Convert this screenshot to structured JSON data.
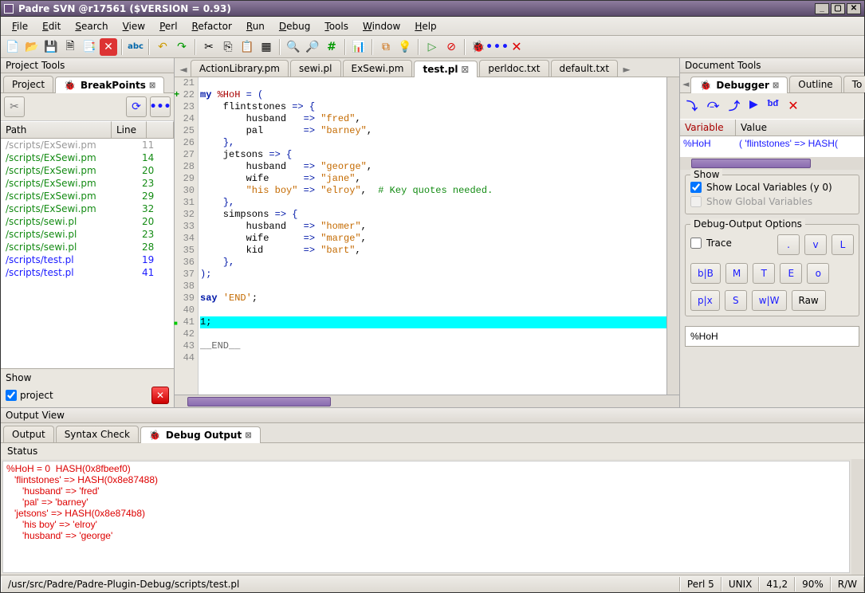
{
  "title": "Padre SVN @r17561 ($VERSION = 0.93)",
  "menus": [
    "File",
    "Edit",
    "Search",
    "View",
    "Perl",
    "Refactor",
    "Run",
    "Debug",
    "Tools",
    "Window",
    "Help"
  ],
  "left_panel": {
    "title": "Project Tools",
    "tabs": {
      "project": "Project",
      "breakpoints": "BreakPoints"
    },
    "columns": {
      "path": "Path",
      "line": "Line"
    },
    "rows": [
      {
        "path": "/scripts/ExSewi.pm",
        "line": "11",
        "cls": "gray"
      },
      {
        "path": "/scripts/ExSewi.pm",
        "line": "14",
        "cls": "green"
      },
      {
        "path": "/scripts/ExSewi.pm",
        "line": "20",
        "cls": "green"
      },
      {
        "path": "/scripts/ExSewi.pm",
        "line": "23",
        "cls": "green"
      },
      {
        "path": "/scripts/ExSewi.pm",
        "line": "29",
        "cls": "green"
      },
      {
        "path": "/scripts/ExSewi.pm",
        "line": "32",
        "cls": "green"
      },
      {
        "path": "/scripts/sewi.pl",
        "line": "20",
        "cls": "green"
      },
      {
        "path": "/scripts/sewi.pl",
        "line": "23",
        "cls": "green"
      },
      {
        "path": "/scripts/sewi.pl",
        "line": "28",
        "cls": "green"
      },
      {
        "path": "/scripts/test.pl",
        "line": "19",
        "cls": "blue"
      },
      {
        "path": "/scripts/test.pl",
        "line": "41",
        "cls": "blue"
      }
    ],
    "show_label": "Show",
    "show_project": "project"
  },
  "file_tabs": [
    "ActionLibrary.pm",
    "sewi.pl",
    "ExSewi.pm",
    "test.pl",
    "perldoc.txt",
    "default.txt"
  ],
  "file_tab_active": 3,
  "code_start_line": 21,
  "code_lines": [
    {
      "n": 21,
      "html": ""
    },
    {
      "n": 22,
      "plus": true,
      "html": "<span class=\"kw\">my</span> <span class=\"var\">%HoH</span> <span class=\"op\">= (</span>"
    },
    {
      "n": 23,
      "html": "    flintstones <span class=\"op\">=&gt; {</span>"
    },
    {
      "n": 24,
      "html": "        husband   <span class=\"op\">=&gt;</span> <span class=\"str\">\"fred\"</span>,"
    },
    {
      "n": 25,
      "html": "        pal       <span class=\"op\">=&gt;</span> <span class=\"str\">\"barney\"</span>,"
    },
    {
      "n": 26,
      "html": "    <span class=\"op\">},</span>"
    },
    {
      "n": 27,
      "html": "    jetsons <span class=\"op\">=&gt; {</span>"
    },
    {
      "n": 28,
      "html": "        husband   <span class=\"op\">=&gt;</span> <span class=\"str\">\"george\"</span>,"
    },
    {
      "n": 29,
      "html": "        wife      <span class=\"op\">=&gt;</span> <span class=\"str\">\"jane\"</span>,"
    },
    {
      "n": 30,
      "html": "        <span class=\"str\">\"his boy\"</span> <span class=\"op\">=&gt;</span> <span class=\"str\">\"elroy\"</span>,  <span class=\"cmt\"># Key quotes needed.</span>"
    },
    {
      "n": 31,
      "html": "    <span class=\"op\">},</span>"
    },
    {
      "n": 32,
      "html": "    simpsons <span class=\"op\">=&gt; {</span>"
    },
    {
      "n": 33,
      "html": "        husband   <span class=\"op\">=&gt;</span> <span class=\"str\">\"homer\"</span>,"
    },
    {
      "n": 34,
      "html": "        wife      <span class=\"op\">=&gt;</span> <span class=\"str\">\"marge\"</span>,"
    },
    {
      "n": 35,
      "html": "        kid       <span class=\"op\">=&gt;</span> <span class=\"str\">\"bart\"</span>,"
    },
    {
      "n": 36,
      "html": "    <span class=\"op\">},</span>"
    },
    {
      "n": 37,
      "html": "<span class=\"op\">);</span>"
    },
    {
      "n": 38,
      "html": ""
    },
    {
      "n": 39,
      "html": "<span class=\"kw\">say</span> <span class=\"str\">'END'</span>;"
    },
    {
      "n": 40,
      "html": ""
    },
    {
      "n": 41,
      "mark": true,
      "hl": true,
      "html": "1;"
    },
    {
      "n": 42,
      "html": ""
    },
    {
      "n": 43,
      "html": "<span class=\"end\">__END__</span>"
    },
    {
      "n": 44,
      "html": ""
    }
  ],
  "right_panel": {
    "title": "Document Tools",
    "tabs": {
      "debugger": "Debugger",
      "outline": "Outline",
      "extra": "To"
    },
    "var_col": "Variable",
    "val_col": "Value",
    "var_name": "%HoH",
    "var_value": "(   'flintstones' => HASH(",
    "show_group": "Show",
    "show_local": "Show Local Variables (y 0)",
    "show_global": "Show Global Variables",
    "out_group": "Debug-Output Options",
    "trace": "Trace",
    "btns1": [
      ".",
      "v",
      "L"
    ],
    "btns2": [
      "b|B",
      "M",
      "T",
      "E",
      "o"
    ],
    "btns3": [
      "p|x",
      "S",
      "w|W",
      "Raw"
    ],
    "input": "%HoH"
  },
  "output_view": {
    "title": "Output View",
    "tabs": [
      "Output",
      "Syntax Check",
      "Debug Output"
    ],
    "active": 2,
    "status": "Status",
    "text": "%HoH = 0  HASH(0x8fbeef0)\n   'flintstones' => HASH(0x8e87488)\n      'husband' => 'fred'\n      'pal' => 'barney'\n   'jetsons' => HASH(0x8e874b8)\n      'his boy' => 'elroy'\n      'husband' => 'george'"
  },
  "statusbar": {
    "path": "/usr/src/Padre/Padre-Plugin-Debug/scripts/test.pl",
    "lang": "Perl 5",
    "os": "UNIX",
    "pos": "41,2",
    "zoom": "90%",
    "rw": "R/W"
  }
}
